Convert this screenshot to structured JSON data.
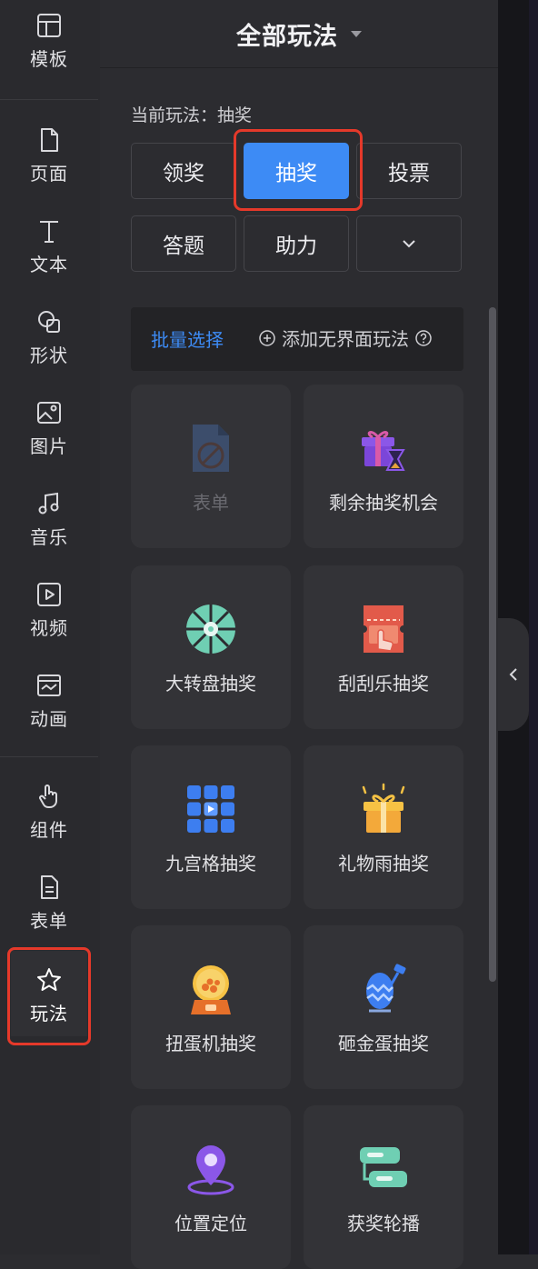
{
  "sidebar": {
    "items": [
      {
        "label": "模板",
        "icon": "layout-icon"
      },
      {
        "label": "页面",
        "icon": "page-icon"
      },
      {
        "label": "文本",
        "icon": "text-icon"
      },
      {
        "label": "形状",
        "icon": "shape-icon"
      },
      {
        "label": "图片",
        "icon": "image-icon"
      },
      {
        "label": "音乐",
        "icon": "music-icon"
      },
      {
        "label": "视频",
        "icon": "video-icon"
      },
      {
        "label": "动画",
        "icon": "animation-icon"
      },
      {
        "label": "组件",
        "icon": "hand-pointer-icon"
      },
      {
        "label": "表单",
        "icon": "form-icon"
      },
      {
        "label": "玩法",
        "icon": "star-icon"
      }
    ],
    "active": "玩法"
  },
  "panel": {
    "title": "全部玩法",
    "current_label": "当前玩法：抽奖",
    "categories": [
      "领奖",
      "抽奖",
      "投票",
      "答题",
      "助力"
    ],
    "active_category": "抽奖",
    "batch_select": "批量选择",
    "add_ui_less": "添加无界面玩法"
  },
  "cards": [
    {
      "label": "表单",
      "icon": "form-disabled-icon",
      "disabled": true
    },
    {
      "label": "剩余抽奖机会",
      "icon": "gift-hourglass-icon"
    },
    {
      "label": "大转盘抽奖",
      "icon": "wheel-icon"
    },
    {
      "label": "刮刮乐抽奖",
      "icon": "scratch-card-icon"
    },
    {
      "label": "九宫格抽奖",
      "icon": "grid-nine-icon"
    },
    {
      "label": "礼物雨抽奖",
      "icon": "gift-box-icon"
    },
    {
      "label": "扭蛋机抽奖",
      "icon": "gacha-icon"
    },
    {
      "label": "砸金蛋抽奖",
      "icon": "egg-hammer-icon"
    },
    {
      "label": "位置定位",
      "icon": "location-pin-icon"
    },
    {
      "label": "获奖轮播",
      "icon": "carousel-icon"
    }
  ],
  "colors": {
    "accent": "#3d8bf5",
    "highlight": "#e5392a",
    "panel_bg": "#2c2c30",
    "card_bg": "#333337"
  }
}
